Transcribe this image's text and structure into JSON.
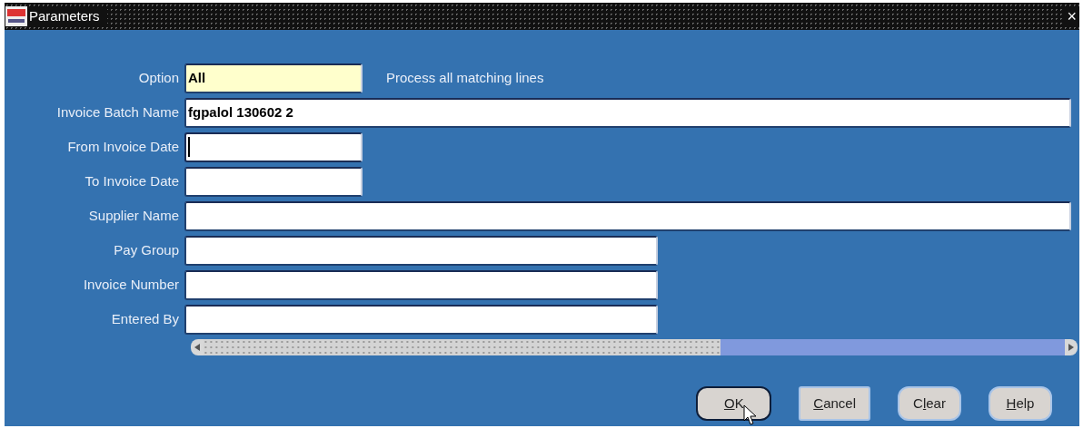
{
  "window": {
    "title": "Parameters",
    "close_label": "×"
  },
  "fields": [
    {
      "label": "Option",
      "value": "All",
      "kind": "short",
      "required": true,
      "focused": false,
      "hint": "Process all matching lines"
    },
    {
      "label": "Invoice Batch Name",
      "value": "fgpalol 130602 2",
      "kind": "long",
      "required": false,
      "focused": false
    },
    {
      "label": "From Invoice Date",
      "kind": "short",
      "required": false,
      "focused": true
    },
    {
      "label": "To Invoice Date",
      "kind": "short",
      "required": false,
      "focused": false
    },
    {
      "label": "Supplier Name",
      "kind": "long",
      "required": false,
      "focused": false
    },
    {
      "label": "Pay Group",
      "kind": "medium",
      "required": false,
      "focused": false
    },
    {
      "label": "Invoice Number",
      "kind": "medium",
      "required": false,
      "focused": false
    },
    {
      "label": "Entered By",
      "kind": "medium",
      "required": false,
      "focused": false
    }
  ],
  "buttons": [
    {
      "key": "O",
      "after": "K",
      "default": true,
      "kind": "rounded"
    },
    {
      "key": "C",
      "after": "ancel",
      "default": false,
      "kind": "square"
    },
    {
      "before": "C",
      "key": "l",
      "after": "ear",
      "default": false,
      "kind": "rounded"
    },
    {
      "key": "H",
      "after": "elp",
      "default": false,
      "kind": "rounded"
    }
  ]
}
